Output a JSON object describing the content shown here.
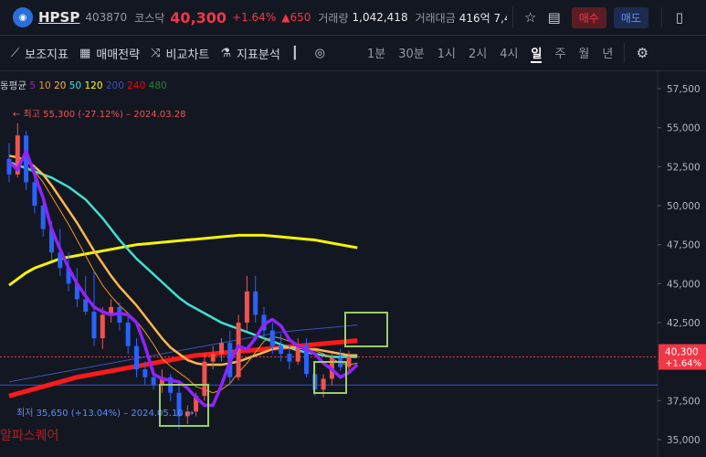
{
  "header": {
    "ticker": "HPSP",
    "code": "403870",
    "market": "코스닥",
    "price": "40,300",
    "change_pct": "+1.64%",
    "change_amt": "▲650",
    "volume_label": "거래량",
    "volume": "1,042,418",
    "value_label": "거래대금",
    "value": "416억 7,4",
    "buy_label": "매수",
    "sell_label": "매도"
  },
  "toolbar": {
    "indicators": "보조지표",
    "strategy": "매매전략",
    "compare": "비교차트",
    "analysis": "지표분석",
    "timeframes": [
      "1분",
      "30분",
      "1시",
      "2시",
      "4시",
      "일",
      "주",
      "월",
      "년"
    ],
    "active_timeframe": "일"
  },
  "chart_data": {
    "type": "line",
    "ma_legend": {
      "prefix": "동평균",
      "entries": [
        {
          "label": "5",
          "color": "#9c27b0"
        },
        {
          "label": "10",
          "color": "#f7931a"
        },
        {
          "label": "20",
          "color": "#ffb74d"
        },
        {
          "label": "50",
          "color": "#40e0d0"
        },
        {
          "label": "120",
          "color": "#ffff00"
        },
        {
          "label": "200",
          "color": "#3f51b5"
        },
        {
          "label": "240",
          "color": "#ff0000"
        },
        {
          "label": "480",
          "color": "#2e7d32"
        }
      ]
    },
    "y_ticks": [
      "57,500",
      "55,000",
      "52,500",
      "50,000",
      "47,500",
      "45,000",
      "42,500",
      "40,000",
      "37,500",
      "35,000"
    ],
    "y_tick_values": [
      57500,
      55000,
      52500,
      50000,
      47500,
      45000,
      42500,
      40000,
      37500,
      35000
    ],
    "ylim": [
      34000,
      58500
    ],
    "current_price_label": "40,300",
    "current_change_label": "+1.64%",
    "current_price": 40300,
    "high_annotation": "최고 55,300 (-27.12%) – 2024.03.28",
    "low_annotation": "최저 35,650 (+13.04%) – 2024.05.10",
    "watermark": "알파스퀘어",
    "ma5": [
      52800,
      52300,
      53500,
      52000,
      50500,
      48500,
      47200,
      46000,
      45000,
      44200,
      43500,
      43200,
      43000,
      43100,
      43000,
      42500,
      41000,
      39200,
      38900,
      38800,
      38700,
      38300,
      37700,
      37200,
      37200,
      38500,
      40000,
      41000,
      40800,
      41500,
      42400,
      42700,
      42300,
      41400,
      41000,
      40800,
      40500,
      39900,
      39500,
      39000,
      39300,
      39800
    ],
    "ma10": [
      52700,
      52600,
      52500,
      52200,
      51500,
      50600,
      49700,
      48800,
      47800,
      46800,
      45800,
      44900,
      44200,
      43600,
      43100,
      42600,
      41900,
      41100,
      40200,
      39700,
      39300,
      38900,
      38400,
      38200,
      38000,
      38200,
      38600,
      39300,
      39900,
      40600,
      41300,
      41600,
      41500,
      41300,
      41100,
      40800,
      40700,
      40500,
      40200,
      39900,
      39800,
      39900
    ],
    "ma20": [
      53200,
      53100,
      52900,
      52500,
      52000,
      51300,
      50500,
      49700,
      48900,
      48000,
      47100,
      46300,
      45500,
      44800,
      44200,
      43600,
      42900,
      42200,
      41500,
      40900,
      40500,
      40100,
      39900,
      39800,
      39800,
      39800,
      39900,
      40000,
      40200,
      40400,
      40600,
      40800,
      40900,
      40900,
      40900,
      40800,
      40800,
      40700,
      40600,
      40500,
      40400,
      40400
    ],
    "ma50": [
      52800,
      52600,
      52400,
      52200,
      52000,
      51800,
      51500,
      51200,
      50800,
      50400,
      49800,
      49200,
      48500,
      47800,
      47200,
      46600,
      46100,
      45600,
      45100,
      44600,
      44100,
      43700,
      43400,
      43100,
      42800,
      42500,
      42300,
      42100,
      41900,
      41700,
      41500,
      41300,
      41100,
      40900,
      40700,
      40600,
      40500,
      40400,
      40300,
      40300,
      40300,
      40300
    ],
    "ma120": [
      44900,
      45300,
      45700,
      46000,
      46200,
      46400,
      46600,
      46700,
      46800,
      46900,
      47000,
      47100,
      47200,
      47300,
      47400,
      47500,
      47550,
      47600,
      47650,
      47700,
      47750,
      47800,
      47850,
      47900,
      47950,
      48000,
      48050,
      48100,
      48100,
      48100,
      48100,
      48050,
      48000,
      47950,
      47900,
      47850,
      47800,
      47700,
      47600,
      47500,
      47400,
      47300
    ],
    "ma200": [
      38700,
      38800,
      38900,
      39000,
      39100,
      39200,
      39300,
      39400,
      39500,
      39600,
      39700,
      39800,
      39900,
      40000,
      40100,
      40200,
      40300,
      40400,
      40500,
      40600,
      40700,
      40800,
      40900,
      41000,
      41100,
      41200,
      41300,
      41400,
      41500,
      41600,
      41700,
      41800,
      41900,
      41950,
      42000,
      42050,
      42100,
      42150,
      42200,
      42250,
      42300,
      42350
    ],
    "ma240": [
      37800,
      37950,
      38100,
      38250,
      38400,
      38550,
      38700,
      38850,
      39000,
      39100,
      39200,
      39300,
      39400,
      39500,
      39600,
      39700,
      39800,
      39900,
      40000,
      40100,
      40200,
      40300,
      40400,
      40450,
      40500,
      40550,
      40600,
      40650,
      40700,
      40750,
      40800,
      40850,
      40900,
      40950,
      41000,
      41050,
      41100,
      41150,
      41200,
      41250,
      41300,
      41350
    ],
    "candles": [
      {
        "o": 53000,
        "h": 54000,
        "l": 51500,
        "c": 52000
      },
      {
        "o": 52000,
        "h": 55300,
        "l": 51800,
        "c": 54500
      },
      {
        "o": 54500,
        "h": 54800,
        "l": 51000,
        "c": 51500
      },
      {
        "o": 51500,
        "h": 52500,
        "l": 49500,
        "c": 50000
      },
      {
        "o": 50000,
        "h": 50500,
        "l": 48000,
        "c": 48500
      },
      {
        "o": 48500,
        "h": 49000,
        "l": 46500,
        "c": 47000
      },
      {
        "o": 47000,
        "h": 48500,
        "l": 45500,
        "c": 46000
      },
      {
        "o": 46000,
        "h": 47000,
        "l": 44500,
        "c": 45000
      },
      {
        "o": 45000,
        "h": 46000,
        "l": 43500,
        "c": 44000
      },
      {
        "o": 44000,
        "h": 45500,
        "l": 43000,
        "c": 43200
      },
      {
        "o": 43200,
        "h": 45800,
        "l": 41000,
        "c": 41500
      },
      {
        "o": 41500,
        "h": 43500,
        "l": 40800,
        "c": 43000
      },
      {
        "o": 43000,
        "h": 44000,
        "l": 42500,
        "c": 43500
      },
      {
        "o": 43500,
        "h": 43800,
        "l": 42000,
        "c": 42500
      },
      {
        "o": 42500,
        "h": 43000,
        "l": 40500,
        "c": 41000
      },
      {
        "o": 41000,
        "h": 41500,
        "l": 39000,
        "c": 39500
      },
      {
        "o": 39500,
        "h": 40000,
        "l": 38500,
        "c": 39000
      },
      {
        "o": 39000,
        "h": 39600,
        "l": 38200,
        "c": 38500
      },
      {
        "o": 38500,
        "h": 39500,
        "l": 38000,
        "c": 39000
      },
      {
        "o": 39000,
        "h": 39200,
        "l": 37500,
        "c": 38000
      },
      {
        "o": 38000,
        "h": 38500,
        "l": 35650,
        "c": 36500
      },
      {
        "o": 36500,
        "h": 37200,
        "l": 36000,
        "c": 36800
      },
      {
        "o": 36800,
        "h": 38000,
        "l": 36500,
        "c": 37800
      },
      {
        "o": 37800,
        "h": 40500,
        "l": 37500,
        "c": 40000
      },
      {
        "o": 40000,
        "h": 41000,
        "l": 39500,
        "c": 40500
      },
      {
        "o": 40500,
        "h": 41500,
        "l": 40000,
        "c": 41200
      },
      {
        "o": 41200,
        "h": 42000,
        "l": 38500,
        "c": 39000
      },
      {
        "o": 39000,
        "h": 43000,
        "l": 38800,
        "c": 42500
      },
      {
        "o": 42500,
        "h": 45500,
        "l": 42000,
        "c": 44500
      },
      {
        "o": 44500,
        "h": 45500,
        "l": 42500,
        "c": 43000
      },
      {
        "o": 43000,
        "h": 43500,
        "l": 41500,
        "c": 42000
      },
      {
        "o": 42000,
        "h": 42500,
        "l": 40500,
        "c": 41000
      },
      {
        "o": 41000,
        "h": 41800,
        "l": 40000,
        "c": 40500
      },
      {
        "o": 40500,
        "h": 41000,
        "l": 39500,
        "c": 40000
      },
      {
        "o": 40000,
        "h": 41500,
        "l": 39800,
        "c": 41000
      },
      {
        "o": 41000,
        "h": 41500,
        "l": 39000,
        "c": 39200
      },
      {
        "o": 39200,
        "h": 39800,
        "l": 37800,
        "c": 38200
      },
      {
        "o": 38200,
        "h": 39200,
        "l": 37700,
        "c": 38900
      },
      {
        "o": 38900,
        "h": 40500,
        "l": 38500,
        "c": 40200
      },
      {
        "o": 40200,
        "h": 40800,
        "l": 39400,
        "c": 39650
      },
      {
        "o": 39650,
        "h": 40700,
        "l": 39300,
        "c": 40300
      }
    ]
  }
}
